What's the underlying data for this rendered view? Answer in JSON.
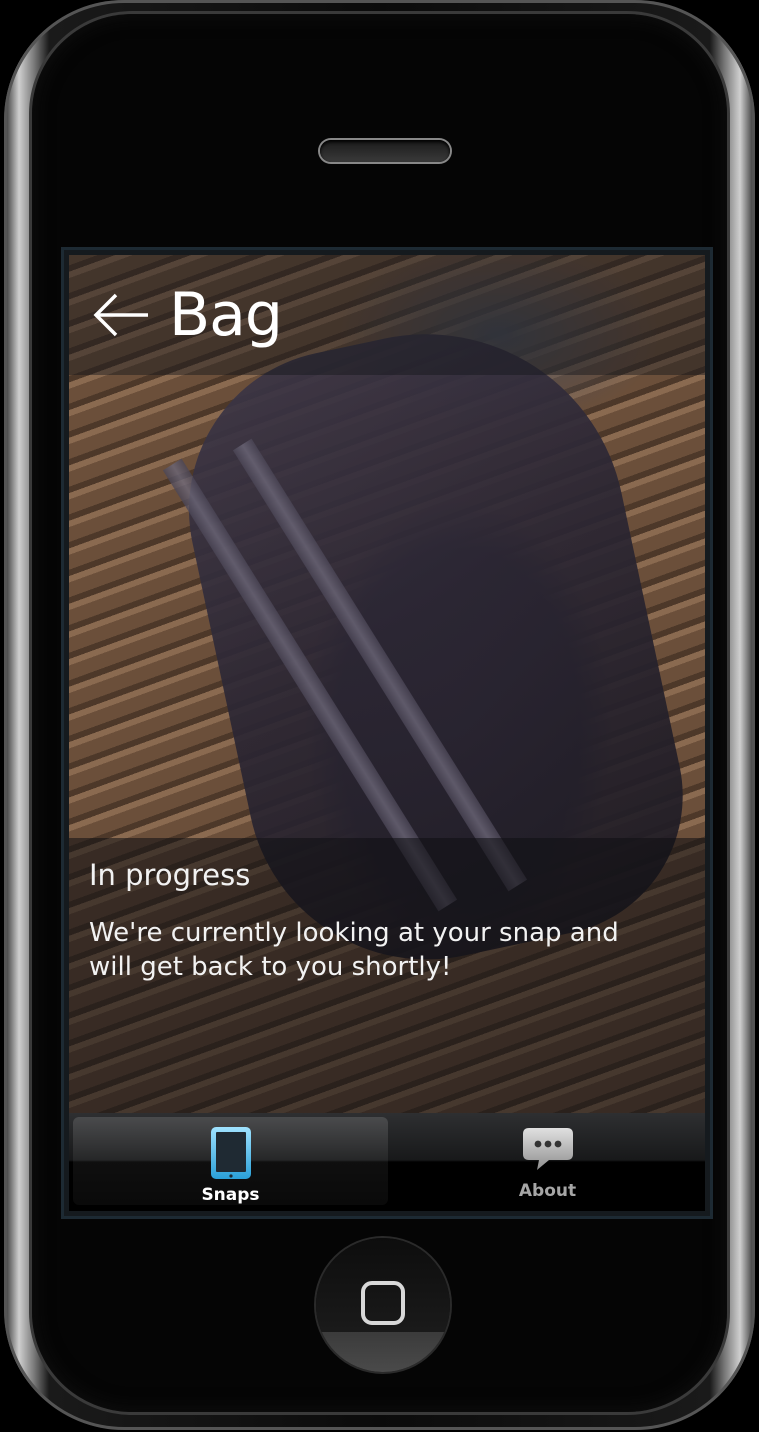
{
  "header": {
    "title": "Bag",
    "back_icon": "arrow-left-icon"
  },
  "status": {
    "title": "In progress",
    "message": "We're currently looking at your snap and will get back to you shortly!"
  },
  "tabbar": {
    "tabs": [
      {
        "label": "Snaps",
        "icon": "tablet-icon",
        "active": true
      },
      {
        "label": "About",
        "icon": "chat-bubble-icon",
        "active": false
      }
    ]
  },
  "colors": {
    "active_tab_icon": "#5ec8f2",
    "inactive_tab_icon": "#b3b3b3",
    "header_text": "#ffffff"
  }
}
